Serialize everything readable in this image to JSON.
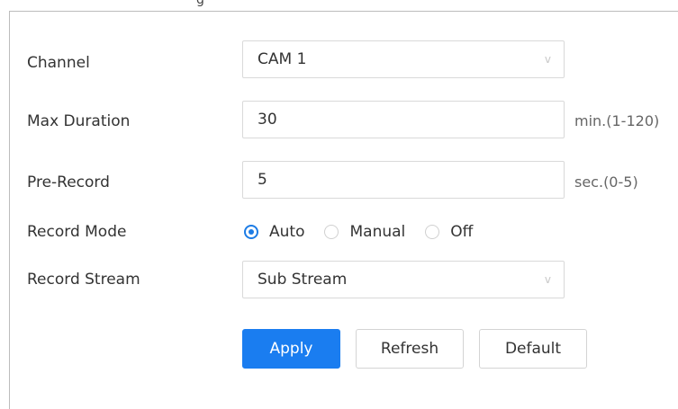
{
  "header": {
    "title_fragment": "g"
  },
  "form": {
    "channel": {
      "label": "Channel",
      "value": "CAM 1",
      "chevron": "v"
    },
    "max_duration": {
      "label": "Max Duration",
      "value": "30",
      "unit": "min.(1-120)"
    },
    "pre_record": {
      "label": "Pre-Record",
      "value": "5",
      "unit": "sec.(0-5)"
    },
    "record_mode": {
      "label": "Record Mode",
      "options": [
        {
          "label": "Auto",
          "checked": true
        },
        {
          "label": "Manual",
          "checked": false
        },
        {
          "label": "Off",
          "checked": false
        }
      ]
    },
    "record_stream": {
      "label": "Record Stream",
      "value": "Sub Stream",
      "chevron": "v"
    }
  },
  "buttons": {
    "apply": "Apply",
    "refresh": "Refresh",
    "default": "Default"
  },
  "colors": {
    "primary": "#1a7df0",
    "radio_checked": "#1d7ce5"
  }
}
